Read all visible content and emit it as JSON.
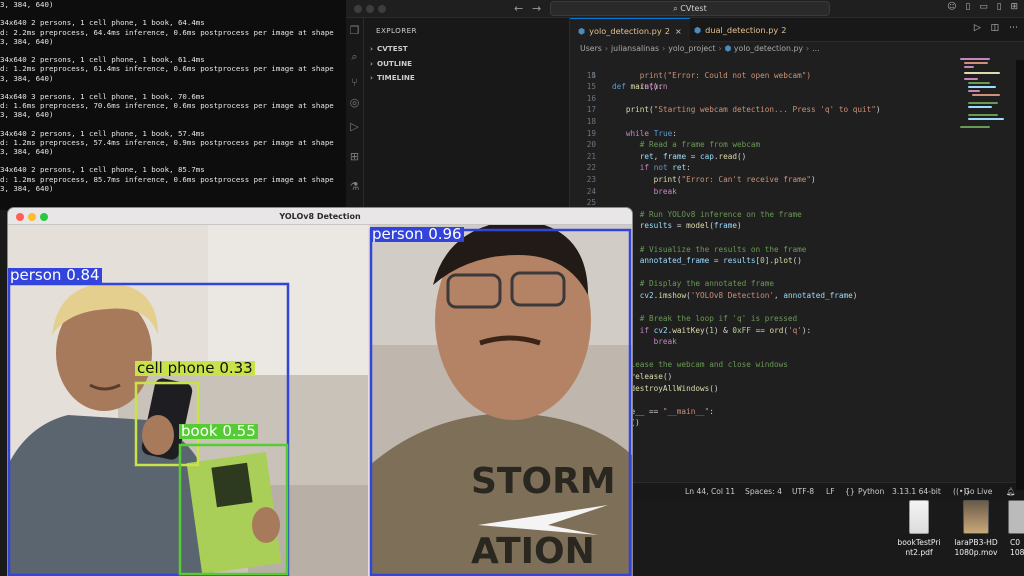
{
  "terminal": {
    "lines": [
      "3, 384, 640)",
      "",
      "34x640 2 persons, 1 cell phone, 1 book, 64.4ms",
      "d: 2.2ms preprocess, 64.4ms inference, 0.6ms postprocess per image at shape",
      "3, 384, 640)",
      "",
      "34x640 2 persons, 1 cell phone, 1 book, 61.4ms",
      "d: 1.2ms preprocess, 61.4ms inference, 0.6ms postprocess per image at shape",
      "3, 384, 640)",
      "",
      "34x640 3 persons, 1 cell phone, 1 book, 70.6ms",
      "d: 1.6ms preprocess, 70.6ms inference, 0.6ms postprocess per image at shape",
      "3, 384, 640)",
      "",
      "34x640 2 persons, 1 cell phone, 1 book, 57.4ms",
      "d: 1.2ms preprocess, 57.4ms inference, 0.9ms postprocess per image at shape",
      "3, 384, 640)",
      "",
      "34x640 2 persons, 1 cell phone, 1 book, 85.7ms",
      "d: 1.2ms preprocess, 85.7ms inference, 0.6ms postprocess per image at shape",
      "3, 384, 640)"
    ]
  },
  "vscode": {
    "command_center": "CVtest",
    "explorer_heading": "EXPLORER",
    "sections": [
      "CVTEST",
      "OUTLINE",
      "TIMELINE"
    ],
    "tabs": [
      {
        "label": "yolo_detection.py",
        "problems": "2",
        "active": true
      },
      {
        "label": "dual_detection.py",
        "problems": "2",
        "active": false
      }
    ],
    "breadcrumb": [
      "Users",
      "juliansalinas",
      "yolo_project",
      "yolo_detection.py",
      "..."
    ],
    "code": [
      {
        "ln": "14",
        "t": [
          [
            "      print(\"Error: Could not open webcam\")",
            "fnstr"
          ]
        ]
      },
      {
        "ln": "15",
        "t": [
          [
            "      ",
            "pl"
          ],
          [
            "return",
            "kw"
          ]
        ]
      },
      {
        "ln": "16",
        "t": []
      },
      {
        "ln": "17",
        "t": [
          [
            "   ",
            "pl"
          ],
          [
            "print",
            "fn"
          ],
          [
            "(",
            "pl"
          ],
          [
            "\"Starting webcam detection... Press 'q' to quit\"",
            "str"
          ],
          [
            ")",
            "pl"
          ]
        ]
      },
      {
        "ln": "18",
        "t": []
      },
      {
        "ln": "19",
        "t": [
          [
            "   ",
            "pl"
          ],
          [
            "while",
            "kw"
          ],
          [
            " ",
            "pl"
          ],
          [
            "True",
            "kw2"
          ],
          [
            ":",
            "pl"
          ]
        ]
      },
      {
        "ln": "20",
        "t": [
          [
            "      ",
            "pl"
          ],
          [
            "# Read a frame from webcam",
            "cm"
          ]
        ]
      },
      {
        "ln": "21",
        "t": [
          [
            "      ",
            "pl"
          ],
          [
            "ret",
            "var"
          ],
          [
            ", ",
            "pl"
          ],
          [
            "frame",
            "var"
          ],
          [
            " = ",
            "pl"
          ],
          [
            "cap",
            "var"
          ],
          [
            ".",
            "pl"
          ],
          [
            "read",
            "fn"
          ],
          [
            "()",
            "pl"
          ]
        ]
      },
      {
        "ln": "22",
        "t": [
          [
            "      ",
            "pl"
          ],
          [
            "if",
            "kw"
          ],
          [
            " ",
            "pl"
          ],
          [
            "not",
            "kw2"
          ],
          [
            " ",
            "pl"
          ],
          [
            "ret",
            "var"
          ],
          [
            ":",
            "pl"
          ]
        ]
      },
      {
        "ln": "23",
        "t": [
          [
            "         ",
            "pl"
          ],
          [
            "print",
            "fn"
          ],
          [
            "(",
            "pl"
          ],
          [
            "\"Error: Can't receive frame\"",
            "str"
          ],
          [
            ")",
            "pl"
          ]
        ]
      },
      {
        "ln": "24",
        "t": [
          [
            "         ",
            "pl"
          ],
          [
            "break",
            "kw"
          ]
        ]
      },
      {
        "ln": "25",
        "t": []
      },
      {
        "ln": "26",
        "t": [
          [
            "      ",
            "pl"
          ],
          [
            "# Run YOLOv8 inference on the frame",
            "cm"
          ]
        ]
      },
      {
        "ln": "27",
        "t": [
          [
            "      ",
            "pl"
          ],
          [
            "results",
            "var"
          ],
          [
            " = ",
            "pl"
          ],
          [
            "model",
            "fn"
          ],
          [
            "(",
            "pl"
          ],
          [
            "frame",
            "var"
          ],
          [
            ")",
            "pl"
          ]
        ]
      },
      {
        "ln": "28",
        "t": []
      },
      {
        "ln": "29",
        "t": [
          [
            "      ",
            "pl"
          ],
          [
            "# Visualize the results on the frame",
            "cm"
          ]
        ]
      },
      {
        "ln": "30",
        "t": [
          [
            "      ",
            "pl"
          ],
          [
            "annotated_frame",
            "var"
          ],
          [
            " = ",
            "pl"
          ],
          [
            "results",
            "var"
          ],
          [
            "[",
            "pl"
          ],
          [
            "0",
            "num"
          ],
          [
            "].",
            "pl"
          ],
          [
            "plot",
            "fn"
          ],
          [
            "()",
            "pl"
          ]
        ]
      },
      {
        "ln": "31",
        "t": []
      },
      {
        "ln": "32",
        "t": [
          [
            "      ",
            "pl"
          ],
          [
            "# Display the annotated frame",
            "cm"
          ]
        ]
      },
      {
        "ln": "33",
        "t": [
          [
            "      ",
            "pl"
          ],
          [
            "cv2",
            "var"
          ],
          [
            ".",
            "pl"
          ],
          [
            "imshow",
            "fn"
          ],
          [
            "(",
            "pl"
          ],
          [
            "'YOLOv8 Detection'",
            "str"
          ],
          [
            ", ",
            "pl"
          ],
          [
            "annotated_frame",
            "var"
          ],
          [
            ")",
            "pl"
          ]
        ]
      },
      {
        "ln": "34",
        "t": []
      },
      {
        "ln": "35",
        "t": [
          [
            "      ",
            "pl"
          ],
          [
            "# Break the loop if 'q' is pressed",
            "cm"
          ]
        ]
      },
      {
        "ln": "36",
        "t": [
          [
            "      ",
            "pl"
          ],
          [
            "if",
            "kw"
          ],
          [
            " ",
            "pl"
          ],
          [
            "cv2",
            "var"
          ],
          [
            ".",
            "pl"
          ],
          [
            "waitKey",
            "fn"
          ],
          [
            "(",
            "pl"
          ],
          [
            "1",
            "num"
          ],
          [
            ") & ",
            "pl"
          ],
          [
            "0xFF",
            "num"
          ],
          [
            " == ",
            "pl"
          ],
          [
            "ord",
            "fn"
          ],
          [
            "(",
            "pl"
          ],
          [
            "'q'",
            "str"
          ],
          [
            "):",
            "pl"
          ]
        ]
      },
      {
        "ln": "37",
        "t": [
          [
            "         ",
            "pl"
          ],
          [
            "break",
            "kw"
          ]
        ]
      },
      {
        "ln": "38",
        "t": []
      },
      {
        "ln": "39",
        "t": [
          [
            "# Release the webcam and close windows",
            "cm"
          ]
        ]
      },
      {
        "ln": "40",
        "t": [
          [
            "cap",
            "var"
          ],
          [
            ".",
            "pl"
          ],
          [
            "release",
            "fn"
          ],
          [
            "()",
            "pl"
          ]
        ]
      },
      {
        "ln": "41",
        "t": [
          [
            "cv2",
            "var"
          ],
          [
            ".",
            "pl"
          ],
          [
            "destroyAllWindows",
            "fn"
          ],
          [
            "()",
            "pl"
          ]
        ]
      },
      {
        "ln": "42",
        "t": []
      },
      {
        "ln": "43",
        "t": [
          [
            "_name__",
            "var"
          ],
          [
            " == ",
            "pl"
          ],
          [
            "\"__main__\"",
            "str"
          ],
          [
            ":",
            "pl"
          ]
        ]
      },
      {
        "ln": "44",
        "t": [
          [
            "main",
            "fn"
          ],
          [
            "()",
            "pl"
          ]
        ]
      }
    ],
    "first_code_line": {
      "ln": "5",
      "keyword": "def",
      "name": "main",
      "rest": "():"
    },
    "status": {
      "position": "Ln 44, Col 11",
      "spaces": "Spaces: 4",
      "encoding": "UTF-8",
      "eol": "LF",
      "language": "Python",
      "interpreter": "3.13.1 64-bit",
      "golive": "Go Live"
    }
  },
  "desktop": [
    {
      "name": "bookTestPrint2.pdf",
      "line1": "bookTestPri",
      "line2": "nt2.pdf"
    },
    {
      "name": "laraPB3-HD1080p.mov",
      "line1": "laraPB3-HD",
      "line2": "1080p.mov"
    },
    {
      "name": "C0",
      "line1": "C0",
      "line2": "108"
    }
  ],
  "yolo_window": {
    "title": "YOLOv8 Detection",
    "detections": [
      {
        "label": "person",
        "confidence": "0.84",
        "color": "#3344dd",
        "text_color": "#ffffff"
      },
      {
        "label": "person",
        "confidence": "0.96",
        "color": "#3344dd",
        "text_color": "#ffffff"
      },
      {
        "label": "cell phone",
        "confidence": "0.33",
        "color": "#c8e34a",
        "text_color": "#111111"
      },
      {
        "label": "book",
        "confidence": "0.55",
        "color": "#55cc33",
        "text_color": "#ffffff"
      }
    ]
  }
}
